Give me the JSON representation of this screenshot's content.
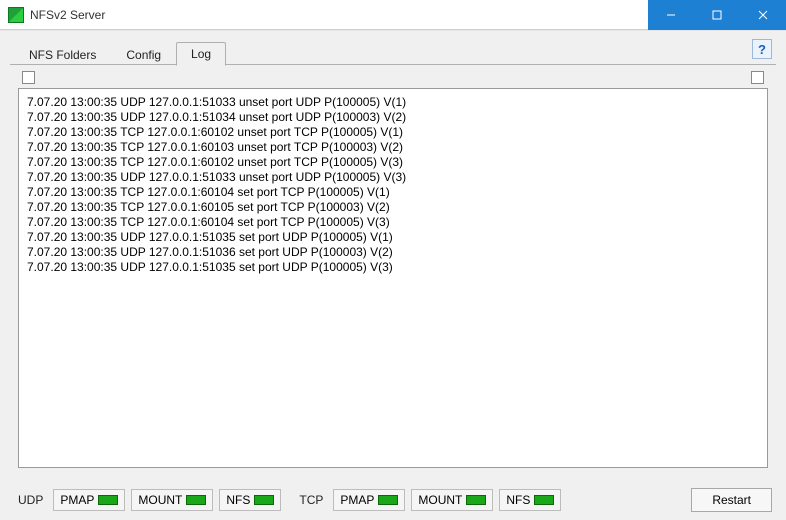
{
  "window": {
    "title": "NFSv2 Server"
  },
  "tabs": {
    "t0": "NFS Folders",
    "t1": "Config",
    "t2": "Log",
    "activeIndex": 2
  },
  "help": {
    "label": "?"
  },
  "log": {
    "lines": [
      "7.07.20 13:00:35 UDP 127.0.0.1:51033 unset port UDP P(100005) V(1)",
      "7.07.20 13:00:35 UDP 127.0.0.1:51034 unset port UDP P(100003) V(2)",
      "7.07.20 13:00:35 TCP 127.0.0.1:60102 unset port TCP P(100005) V(1)",
      "7.07.20 13:00:35 TCP 127.0.0.1:60103 unset port TCP P(100003) V(2)",
      "7.07.20 13:00:35 TCP 127.0.0.1:60102 unset port TCP P(100005) V(3)",
      "7.07.20 13:00:35 UDP 127.0.0.1:51033 unset port UDP P(100005) V(3)",
      "7.07.20 13:00:35 TCP 127.0.0.1:60104 set port TCP P(100005) V(1)",
      "7.07.20 13:00:35 TCP 127.0.0.1:60105 set port TCP P(100003) V(2)",
      "7.07.20 13:00:35 TCP 127.0.0.1:60104 set port TCP P(100005) V(3)",
      "7.07.20 13:00:35 UDP 127.0.0.1:51035 set port UDP P(100005) V(1)",
      "7.07.20 13:00:35 UDP 127.0.0.1:51036 set port UDP P(100003) V(2)",
      "7.07.20 13:00:35 UDP 127.0.0.1:51035 set port UDP P(100005) V(3)"
    ]
  },
  "status": {
    "udpLabel": "UDP",
    "tcpLabel": "TCP",
    "pmap": "PMAP",
    "mount": "MOUNT",
    "nfs": "NFS",
    "restart": "Restart",
    "ledColor": "#1aa81a"
  }
}
